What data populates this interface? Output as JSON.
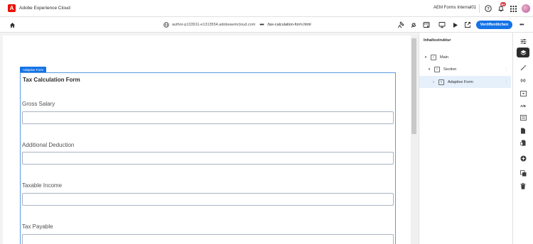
{
  "topbar": {
    "app_title": "Adobe Experience Cloud",
    "org": "AEM Forms Internal01",
    "notification_count": "9+"
  },
  "toolbar": {
    "host": "author-p133911-e1313554.adobeaemcloud.com",
    "more": "•••",
    "path": "/tax-calculation-form.html",
    "publish_label": "Veröffentlichen",
    "more_actions": "•••"
  },
  "canvas": {
    "selection_label": "Adaptive Form",
    "form_title": "Tax Calculation Form",
    "fields": [
      {
        "label": "Gross Salary",
        "value": ""
      },
      {
        "label": "Additional Deduction",
        "value": ""
      },
      {
        "label": "Taxable Income",
        "value": ""
      },
      {
        "label": "Tax Payable",
        "value": ""
      }
    ]
  },
  "content_tree": {
    "title": "Inhaltsstruktur",
    "nodes": [
      {
        "label": "Main",
        "level": 0,
        "expanded": true
      },
      {
        "label": "Section",
        "level": 1,
        "expanded": true
      },
      {
        "label": "Adaptive Form",
        "level": 2,
        "expanded": false,
        "selected": true
      }
    ]
  },
  "rail": {
    "variables_label": "{x}",
    "ab_label": "A/B"
  },
  "colors": {
    "accent": "#1473e6",
    "adobe_red": "#eb1000",
    "selection_bg": "#e5f0fb"
  }
}
